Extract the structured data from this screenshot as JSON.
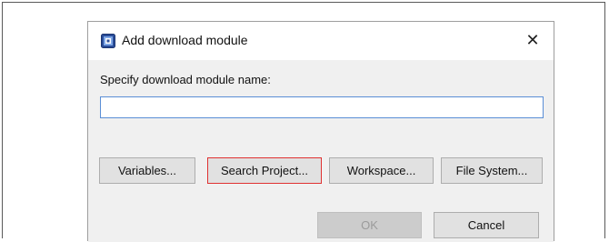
{
  "dialog": {
    "title": "Add download module",
    "close_symbol": "✕",
    "icon": "app-module-icon"
  },
  "form": {
    "prompt": "Specify download module name:",
    "name_value": "",
    "name_placeholder": ""
  },
  "source_buttons": {
    "variables": "Variables...",
    "search_project": "Search Project...",
    "workspace": "Workspace...",
    "file_system": "File System..."
  },
  "actions": {
    "ok": "OK",
    "cancel": "Cancel"
  },
  "colors": {
    "highlight": "#e03131",
    "input_border": "#5a8ed6",
    "panel_bg": "#f0f0f0"
  }
}
